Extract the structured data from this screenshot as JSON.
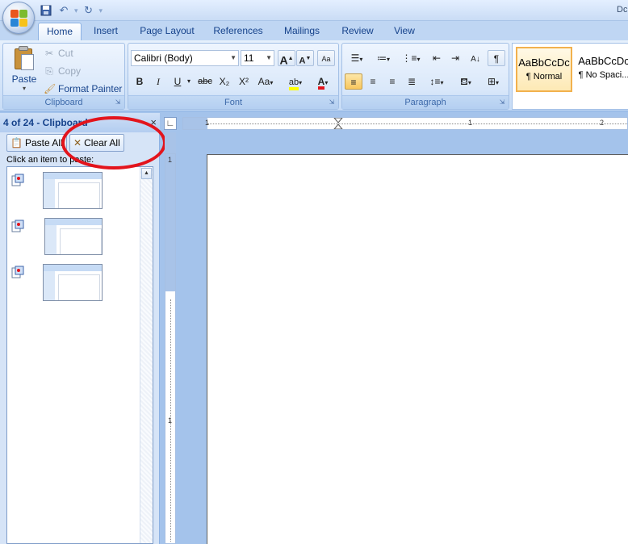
{
  "window": {
    "title_partial": "Dc"
  },
  "tabs": [
    {
      "label": "Home",
      "active": true
    },
    {
      "label": "Insert"
    },
    {
      "label": "Page Layout"
    },
    {
      "label": "References"
    },
    {
      "label": "Mailings"
    },
    {
      "label": "Review"
    },
    {
      "label": "View"
    }
  ],
  "clipboard_group": {
    "label": "Clipboard",
    "paste": "Paste",
    "cut": "Cut",
    "copy": "Copy",
    "format_painter": "Format Painter"
  },
  "font_group": {
    "label": "Font",
    "font_name": "Calibri (Body)",
    "font_size": "11",
    "bold": "B",
    "italic": "I",
    "underline": "U",
    "strikethrough": "abc",
    "subscript": "X₂",
    "superscript": "X²",
    "change_case": "Aa",
    "grow": "A",
    "shrink": "A"
  },
  "paragraph_group": {
    "label": "Paragraph"
  },
  "styles": [
    {
      "sample": "AaBbCcDc",
      "name": "¶ Normal",
      "selected": true
    },
    {
      "sample": "AaBbCcDc",
      "name": "¶ No Spaci..."
    }
  ],
  "pane": {
    "title": "4 of 24 - Clipboard",
    "close": "×",
    "paste_all": "Paste All",
    "clear_all": "Clear All",
    "hint": "Click an item to paste:",
    "items": 3
  },
  "ruler": {
    "h_labels": [
      "1",
      "1",
      "2"
    ],
    "v_labels": [
      "1",
      "1"
    ]
  },
  "colors": {
    "highlight_ring": "#e3141c",
    "ribbon_bg": "#d5e5f9",
    "workspace": "#a4c3eb"
  }
}
